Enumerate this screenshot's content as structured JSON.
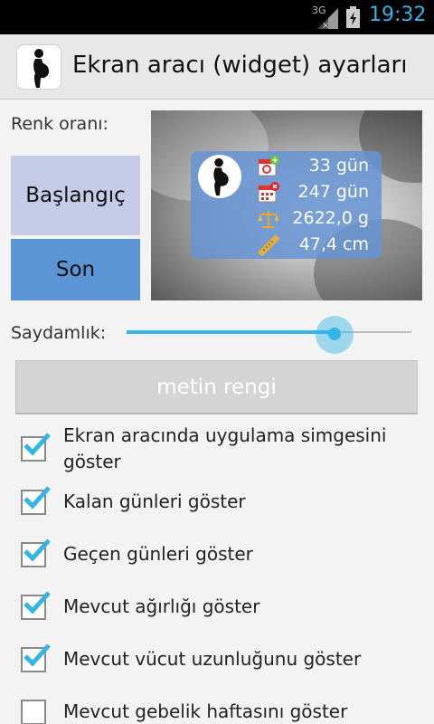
{
  "status_bar": {
    "network_label": "3G",
    "time": "19:32",
    "accent": "#33b5e5"
  },
  "action_bar": {
    "title": "Ekran aracı (widget) ayarları",
    "icon": "pregnant-woman-icon"
  },
  "color_section": {
    "label": "Renk oranı:",
    "start_button": "Başlangıç",
    "end_button": "Son",
    "start_color": "#c6cce8",
    "end_color": "#5b95d6"
  },
  "widget_preview": {
    "rows": [
      {
        "icon": "calendar-plus-icon",
        "value": "33 gün"
      },
      {
        "icon": "calendar-minus-icon",
        "value": "247 gün"
      },
      {
        "icon": "scale-icon",
        "value": "2622,0 g"
      },
      {
        "icon": "ruler-icon",
        "value": "47,4 cm"
      }
    ]
  },
  "transparency": {
    "label": "Saydamlık:",
    "value": 0.73
  },
  "text_color_button": "metin rengi",
  "options": [
    {
      "label": "Ekran aracında uygulama simgesini göster",
      "checked": true
    },
    {
      "label": "Kalan günleri göster",
      "checked": true
    },
    {
      "label": "Geçen günleri göster",
      "checked": true
    },
    {
      "label": "Mevcut ağırlığı göster",
      "checked": true
    },
    {
      "label": "Mevcut vücut uzunluğunu göster",
      "checked": true
    },
    {
      "label": "Mevcut gebelik haftasını göster",
      "checked": false
    }
  ]
}
